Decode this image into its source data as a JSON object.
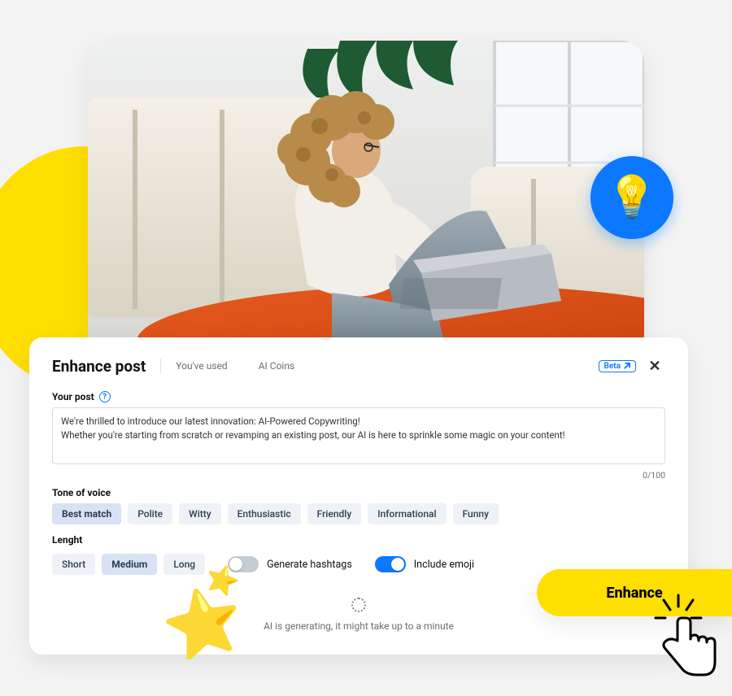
{
  "hero": {
    "badge_icon": "lightbulb-icon"
  },
  "modal": {
    "title": "Enhance post",
    "used_label": "You've used",
    "coins_label": "AI Coins",
    "beta_label": "Beta",
    "post_section_label": "Your post",
    "post_value": "We're thrilled to introduce our latest innovation: AI-Powered Copywriting!\nWhether you're starting from scratch or revamping an existing post, our AI is here to sprinkle some magic on your content!",
    "counter": "0/100",
    "tone_label": "Tone of voice",
    "tone_options": [
      "Best match",
      "Polite",
      "Witty",
      "Enthusiastic",
      "Friendly",
      "Informational",
      "Funny"
    ],
    "tone_selected": "Best match",
    "length_label": "Lenght",
    "length_options": [
      "Short",
      "Medium",
      "Long"
    ],
    "length_selected": "Medium",
    "hashtags_label": "Generate hashtags",
    "hashtags_on": false,
    "emoji_label": "Include emoji",
    "emoji_on": true,
    "generating_text": "AI is generating, it might take up to a minute"
  },
  "cta": {
    "enhance_label": "Enhance"
  }
}
